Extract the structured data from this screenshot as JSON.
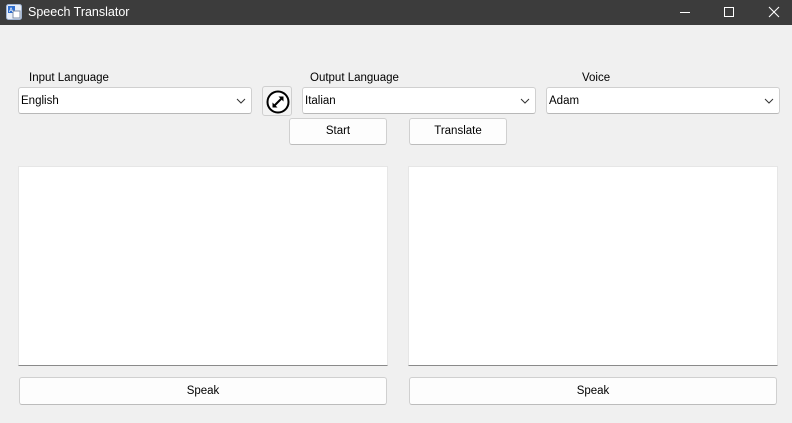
{
  "window": {
    "title": "Speech Translator",
    "controls": {
      "minimize": "minimize-icon",
      "maximize": "maximize-icon",
      "close": "close-icon"
    }
  },
  "input_language": {
    "label": "Input Language",
    "value": "English"
  },
  "swap": {
    "icon": "swap-languages-icon"
  },
  "output_language": {
    "label": "Output Language",
    "value": "Italian"
  },
  "voice": {
    "label": "Voice",
    "value": "Adam"
  },
  "actions": {
    "start_label": "Start",
    "translate_label": "Translate"
  },
  "input_panel": {
    "text": "",
    "speak_label": "Speak"
  },
  "output_panel": {
    "text": "",
    "speak_label": "Speak"
  },
  "colors": {
    "titlebar": "#3c3c3c",
    "window_background": "#f0f0f0",
    "field_background": "#ffffff"
  }
}
